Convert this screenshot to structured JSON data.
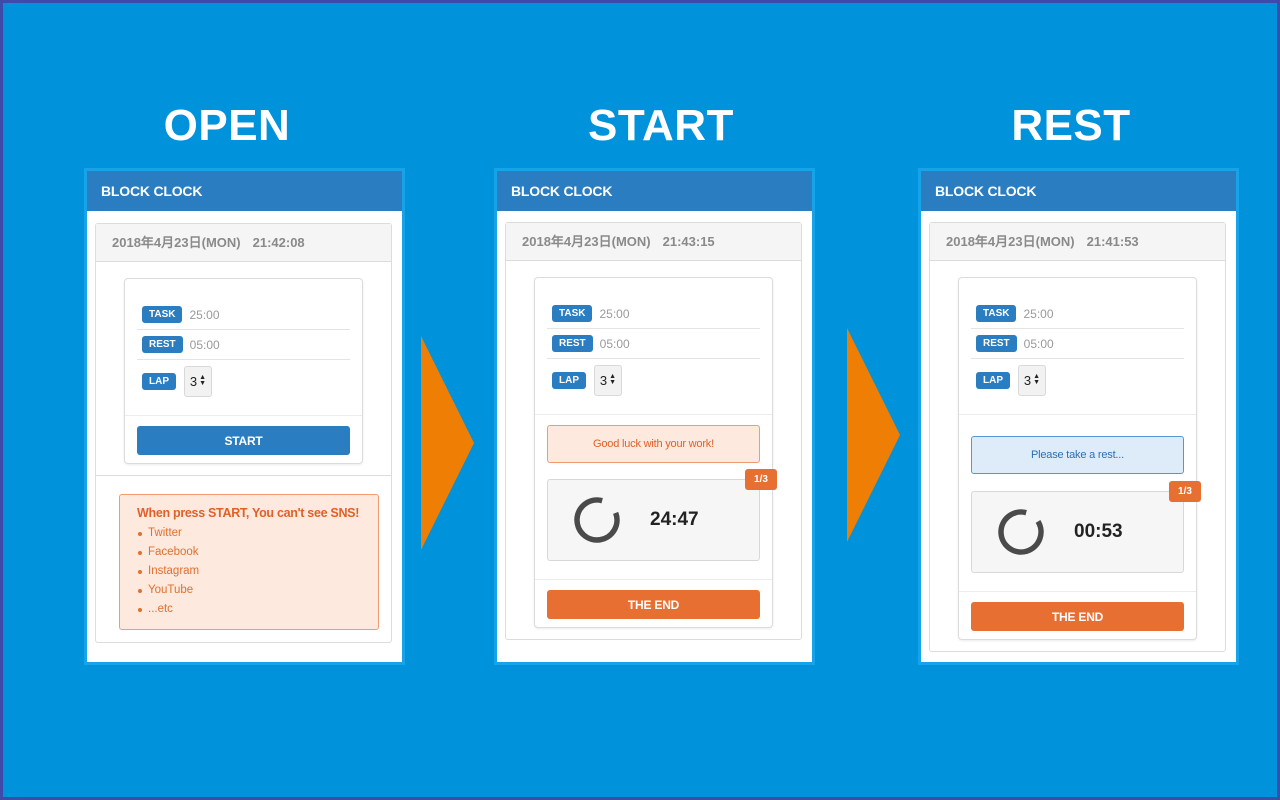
{
  "colors": {
    "background": "#0092db",
    "arrow": "#ef7e05",
    "brand_blue": "#2a7dc0",
    "accent_orange": "#e76f32"
  },
  "stages": [
    {
      "title": "OPEN",
      "app_title": "BLOCK CLOCK",
      "date": "2018年4月23日(MON)",
      "time": "21:42:08",
      "settings": {
        "task_label": "TASK",
        "task_value": "25:00",
        "rest_label": "REST",
        "rest_value": "05:00",
        "lap_label": "LAP",
        "lap_value": "3"
      },
      "start_button": "START",
      "notice": {
        "title": "When press START, You can't see SNS!",
        "items": [
          "Twitter",
          "Facebook",
          "Instagram",
          "YouTube",
          "...etc"
        ]
      }
    },
    {
      "title": "START",
      "app_title": "BLOCK CLOCK",
      "date": "2018年4月23日(MON)",
      "time": "21:43:15",
      "settings": {
        "task_label": "TASK",
        "task_value": "25:00",
        "rest_label": "REST",
        "rest_value": "05:00",
        "lap_label": "LAP",
        "lap_value": "3"
      },
      "message": "Good luck with your work!",
      "lap_counter": "1/3",
      "countdown": "24:47",
      "progress": 0.85,
      "end_button": "THE END"
    },
    {
      "title": "REST",
      "app_title": "BLOCK CLOCK",
      "date": "2018年4月23日(MON)",
      "time": "21:41:53",
      "settings": {
        "task_label": "TASK",
        "task_value": "25:00",
        "rest_label": "REST",
        "rest_value": "05:00",
        "lap_label": "LAP",
        "lap_value": "3"
      },
      "message": "Please take a rest...",
      "lap_counter": "1/3",
      "countdown": "00:53",
      "progress": 0.88,
      "end_button": "THE END"
    }
  ]
}
